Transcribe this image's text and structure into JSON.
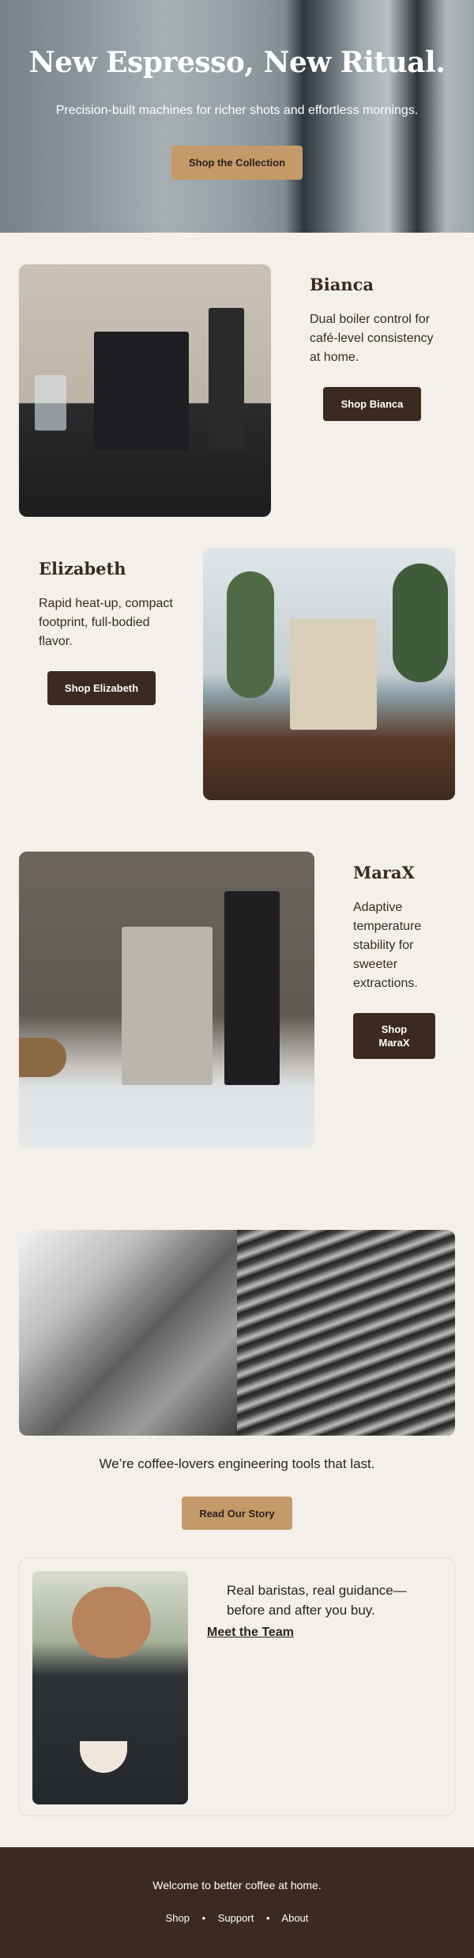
{
  "hero": {
    "title": "New Espresso, New Ritual.",
    "subtitle": "Precision-built machines for richer shots and effortless mornings.",
    "cta": "Shop the Collection"
  },
  "products": [
    {
      "name": "Bianca",
      "description": "Dual boiler control for café-level consistency at home.",
      "cta": "Shop Bianca"
    },
    {
      "name": "Elizabeth",
      "description": "Rapid heat-up, compact footprint, full-bodied flavor.",
      "cta": "Shop Elizabeth"
    },
    {
      "name": "MaraX",
      "description": "Adaptive temperature stability for sweeter extractions.",
      "cta": "Shop MaraX"
    }
  ],
  "story": {
    "text": "We’re coffee-lovers engineering tools that last.",
    "cta": "Read Our Story"
  },
  "team": {
    "text": "Real baristas, real guidance—before and after you buy.",
    "link": "Meet the Team"
  },
  "footer": {
    "tagline": "Welcome to better coffee at home.",
    "nav": [
      "Shop",
      "Support",
      "About"
    ],
    "separator": "•"
  },
  "colors": {
    "accent": "#c49a69",
    "dark": "#3c2a22",
    "background": "#f3efea"
  }
}
